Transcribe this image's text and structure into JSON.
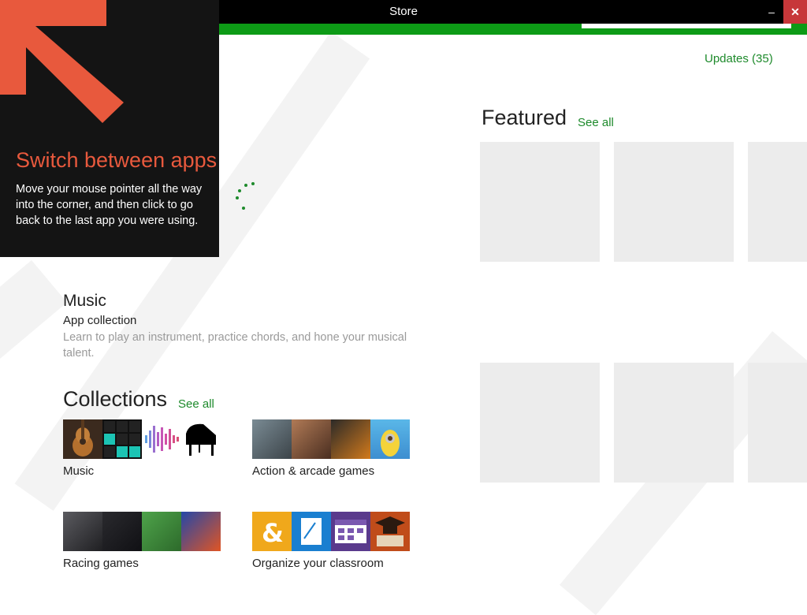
{
  "window": {
    "title": "Store",
    "minimize_glyph": "–",
    "close_glyph": "✕"
  },
  "tip": {
    "title": "Switch between apps",
    "body": "Move your mouse pointer all the way into the corner, and then click to go back to the last app you were using.",
    "arrow_icon": "corner-arrow-icon",
    "accent": "#e8593d"
  },
  "header": {
    "updates_label": "Updates (35)"
  },
  "featured": {
    "heading": "Featured",
    "see_all": "See all"
  },
  "music_promo": {
    "title": "Music",
    "subtitle": "App collection",
    "description": "Learn to play an instrument, practice chords, and hone your musical talent."
  },
  "collections": {
    "heading": "Collections",
    "see_all": "See all",
    "items": [
      {
        "label": "Music"
      },
      {
        "label": "Action & arcade games"
      },
      {
        "label": "Racing games"
      },
      {
        "label": "Organize your classroom"
      }
    ]
  },
  "colors": {
    "accent_green": "#1d8a2b",
    "store_bar": "#0d9b16",
    "tile": "#ececec"
  }
}
